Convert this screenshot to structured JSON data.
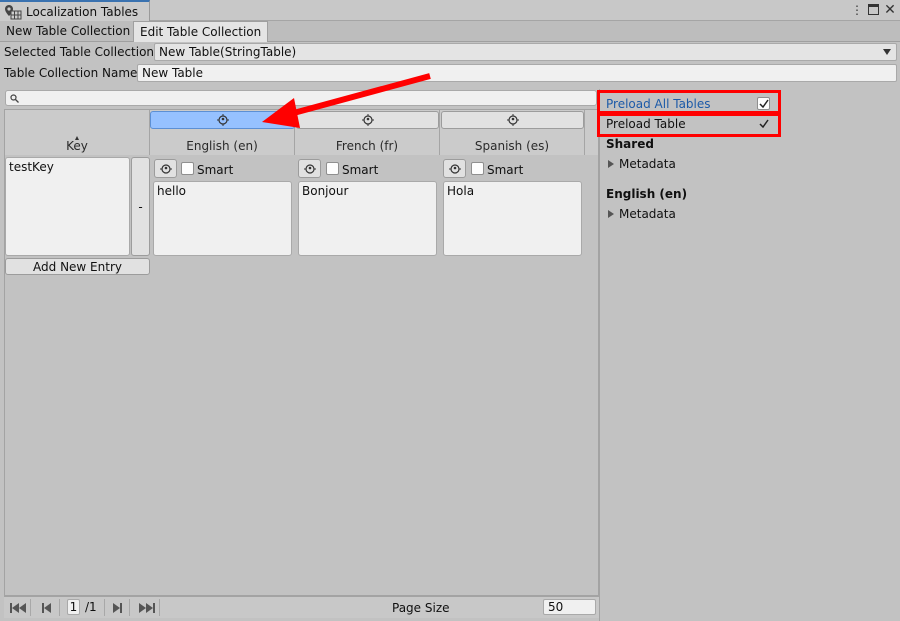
{
  "window": {
    "title": "Localization Tables",
    "controls": [
      "more-icon",
      "maximize-icon",
      "close-icon"
    ]
  },
  "tabs": [
    {
      "label": "New Table Collection",
      "active": false
    },
    {
      "label": "Edit Table Collection",
      "active": true
    }
  ],
  "form": {
    "selected_label": "Selected Table Collection",
    "selected_value": "New Table(StringTable)",
    "name_label": "Table Collection Name",
    "name_value": "New Table"
  },
  "search": {
    "placeholder": ""
  },
  "grid": {
    "key_header": "Key",
    "columns": [
      {
        "name": "English (en)",
        "selected": true
      },
      {
        "name": "French (fr)",
        "selected": false
      },
      {
        "name": "Spanish (es)",
        "selected": false
      }
    ],
    "rows": [
      {
        "key": "testKey",
        "remove_label": "-",
        "smart_label": "Smart",
        "values": [
          "hello",
          "Bonjour",
          "Hola"
        ]
      }
    ],
    "add_entry_label": "Add New Entry"
  },
  "pagination": {
    "current_page": "1",
    "total_pages": "/1",
    "page_size_label": "Page Size",
    "page_size_value": "50"
  },
  "inspector": {
    "preload_all_label": "Preload All Tables",
    "preload_all_checked": true,
    "preload_table_label": "Preload Table",
    "preload_table_checked": true,
    "shared_heading": "Shared",
    "shared_metadata": "Metadata",
    "english_heading": "English (en)",
    "english_metadata": "Metadata"
  },
  "colors": {
    "highlight_box": "#ff0000",
    "arrow": "#ff0000",
    "selected_column": "#96c1ff",
    "link_text": "#1c5aa8"
  }
}
